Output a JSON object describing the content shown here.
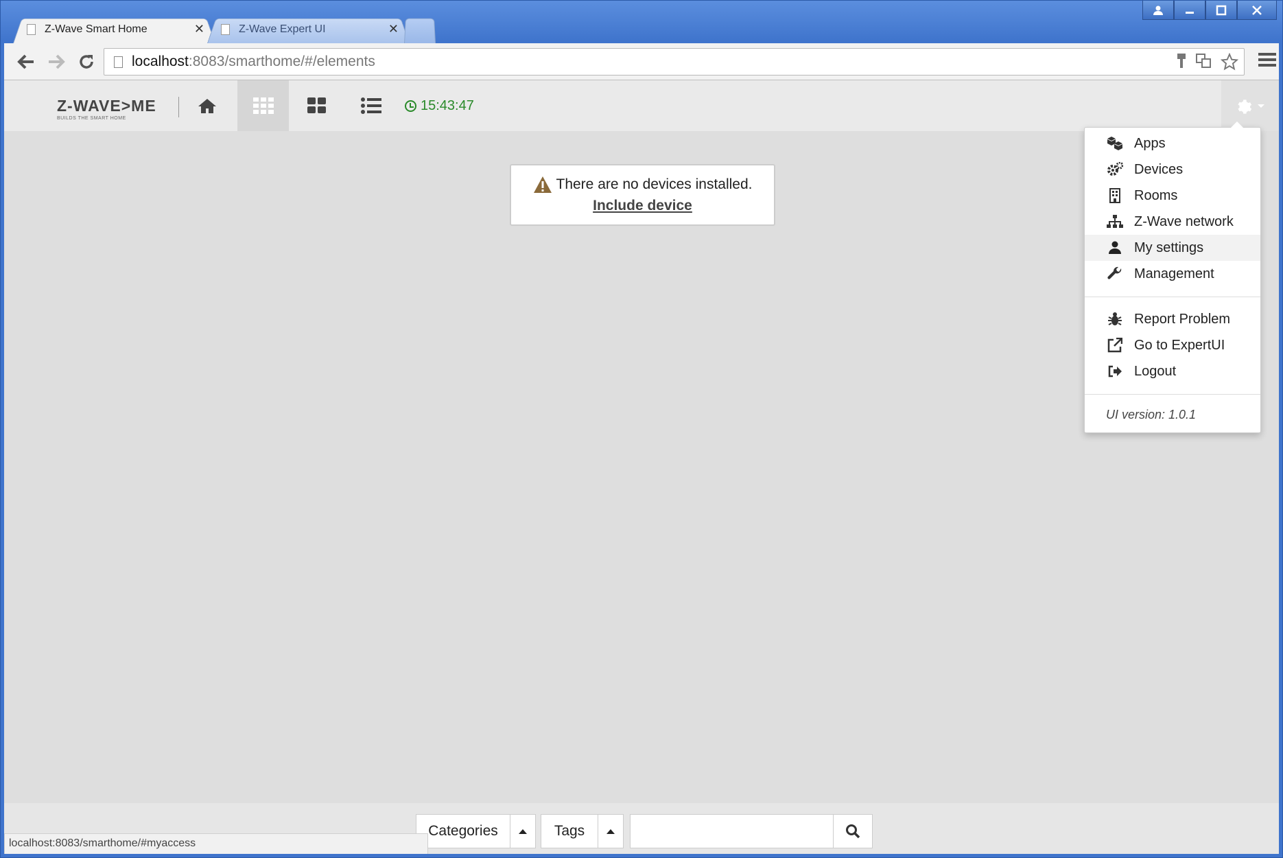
{
  "browser": {
    "tabs": [
      {
        "title": "Z-Wave Smart Home",
        "active": true
      },
      {
        "title": "Z-Wave Expert UI",
        "active": false
      }
    ],
    "url_host": "localhost",
    "url_rest": ":8083/smarthome/#/elements",
    "status_url": "localhost:8083/smarthome/#myaccess"
  },
  "app": {
    "logo_brand": "Z-WAVE>ME",
    "logo_slogan": "BUILDS THE SMART HOME",
    "clock": "15:43:47",
    "accent_color": "#2a8a2a"
  },
  "alert": {
    "message": "There are no devices installed.",
    "link": "Include device",
    "icon": "warning-icon",
    "icon_color": "#8a6a3a"
  },
  "menu": {
    "items": [
      {
        "label": "Apps",
        "icon": "cubes-icon"
      },
      {
        "label": "Devices",
        "icon": "cogs-icon"
      },
      {
        "label": "Rooms",
        "icon": "building-icon"
      },
      {
        "label": "Z-Wave network",
        "icon": "sitemap-icon"
      },
      {
        "label": "My settings",
        "icon": "user-icon"
      },
      {
        "label": "Management",
        "icon": "wrench-icon"
      }
    ],
    "items2": [
      {
        "label": "Report Problem",
        "icon": "bug-icon"
      },
      {
        "label": "Go to ExpertUI",
        "icon": "external-link-icon"
      },
      {
        "label": "Logout",
        "icon": "sign-out-icon"
      }
    ],
    "version": "UI version: 1.0.1"
  },
  "filter": {
    "categories_label": "Categories",
    "tags_label": "Tags",
    "search_value": ""
  }
}
